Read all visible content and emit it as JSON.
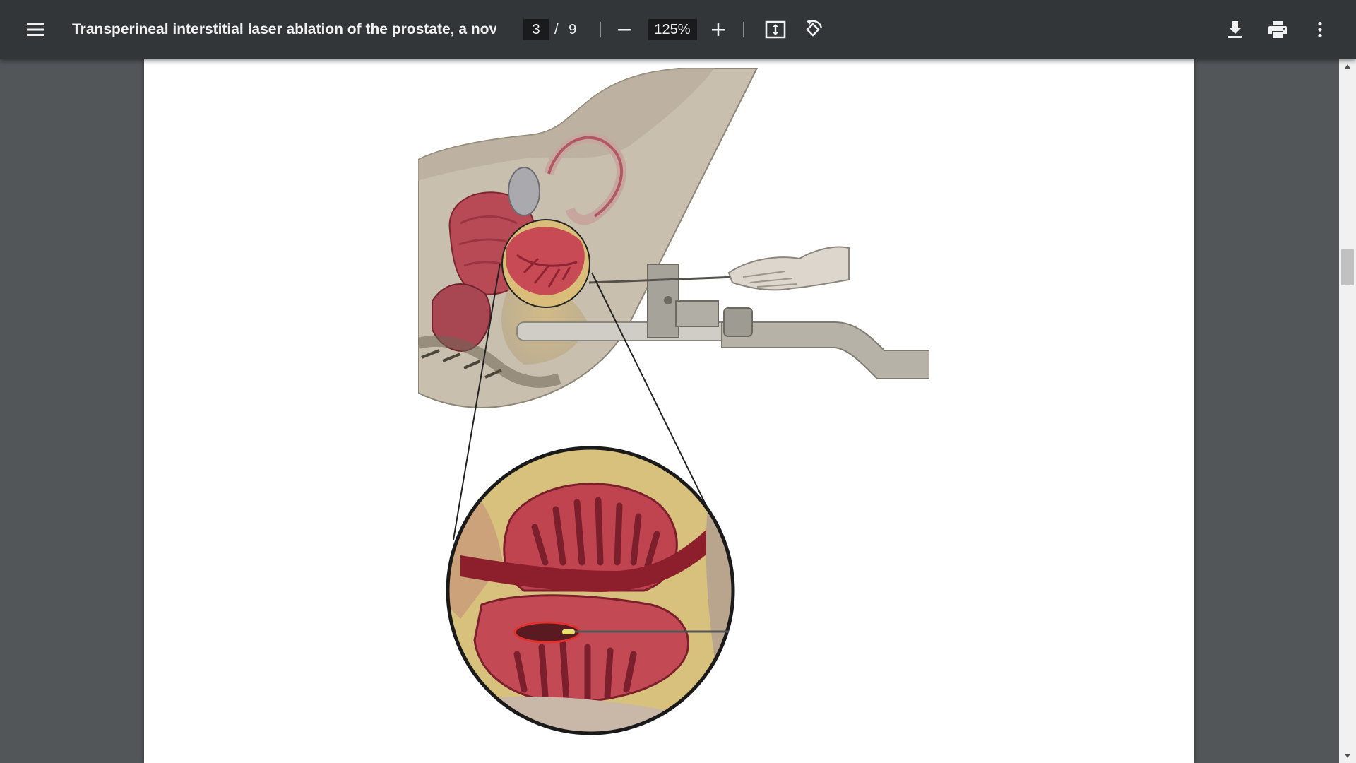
{
  "toolbar": {
    "menu_icon": "menu-icon",
    "title": "Transperineal interstitial laser ablation of the prostate, a novel ...",
    "current_page": "3",
    "page_separator": "/",
    "total_pages": "9",
    "zoom_out_icon": "minus-icon",
    "zoom_level": "125%",
    "zoom_in_icon": "plus-icon",
    "fit_icon": "fit-to-page-icon",
    "rotate_icon": "rotate-icon",
    "download_icon": "download-icon",
    "print_icon": "print-icon",
    "more_icon": "more-vert-icon",
    "background_color": "#323639"
  },
  "document": {
    "figure": {
      "kind": "medical illustration",
      "subject": "sagittal pelvic anatomy with transperineal laser fiber and magnified inset of the prostate",
      "accent_color": "#b8323b"
    }
  },
  "viewer": {
    "background_color": "#525659",
    "scroll_position_fraction": 0.25
  }
}
